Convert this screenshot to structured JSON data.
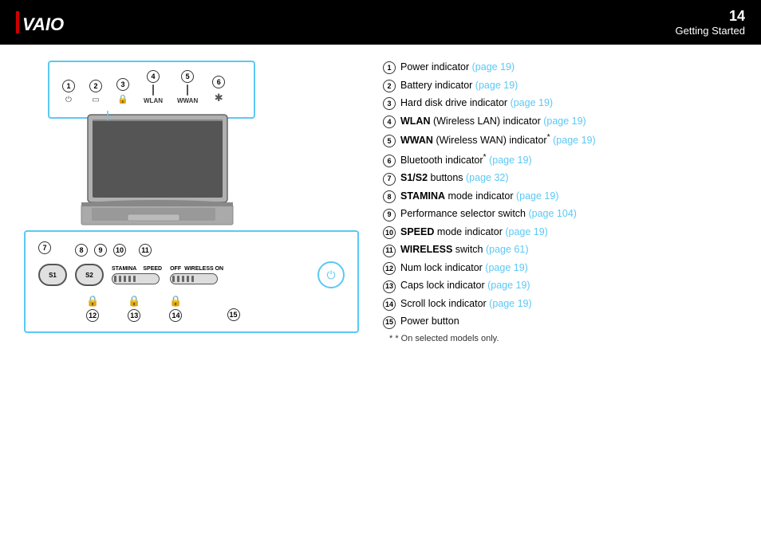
{
  "header": {
    "logo": "VAIO",
    "page_number": "14",
    "section": "Getting Started"
  },
  "items": [
    {
      "num": "1",
      "text": "Power indicator ",
      "link": "page 19",
      "link_page": "19",
      "bold": ""
    },
    {
      "num": "2",
      "text": "Battery indicator ",
      "link": "page 19",
      "bold": ""
    },
    {
      "num": "3",
      "text": "Hard disk drive indicator ",
      "link": "page 19",
      "bold": ""
    },
    {
      "num": "4",
      "text": " (Wireless LAN) indicator ",
      "link": "page 19",
      "bold": "WLAN"
    },
    {
      "num": "5",
      "text": " (Wireless WAN) indicator* ",
      "link": "page 19",
      "bold": "WWAN"
    },
    {
      "num": "6",
      "text": "Bluetooth indicator* ",
      "link": "page 19",
      "bold": ""
    },
    {
      "num": "7",
      "text": " buttons ",
      "link": "page 32",
      "bold": "S1/S2"
    },
    {
      "num": "8",
      "text": " mode indicator ",
      "link": "page 19",
      "bold": "STAMINA"
    },
    {
      "num": "9",
      "text": "Performance selector switch ",
      "link": "page 104",
      "bold": ""
    },
    {
      "num": "10",
      "text": " mode indicator ",
      "link": "page 19",
      "bold": "SPEED"
    },
    {
      "num": "11",
      "text": " switch ",
      "link": "page 61",
      "bold": "WIRELESS"
    },
    {
      "num": "12",
      "text": "Num lock indicator ",
      "link": "page 19",
      "bold": ""
    },
    {
      "num": "13",
      "text": "Caps lock indicator ",
      "link": "page 19",
      "bold": ""
    },
    {
      "num": "14",
      "text": "Scroll lock indicator ",
      "link": "page 19",
      "bold": ""
    },
    {
      "num": "15",
      "text": "Power button",
      "link": "",
      "bold": ""
    }
  ],
  "footnote": "* On selected models only.",
  "top_indicators": [
    {
      "num": "1",
      "icon": "⏻",
      "label": ""
    },
    {
      "num": "2",
      "icon": "▭",
      "label": ""
    },
    {
      "num": "3",
      "icon": "🔒",
      "label": ""
    },
    {
      "num": "4",
      "icon": "",
      "label": "WLAN"
    },
    {
      "num": "5",
      "icon": "",
      "label": "WWAN"
    },
    {
      "num": "6",
      "icon": "✱",
      "label": ""
    }
  ],
  "bottom_indicators": {
    "left_nums": [
      "7",
      "8",
      "9",
      "10",
      "11"
    ],
    "bottom_nums": [
      "12",
      "13",
      "14",
      "15"
    ]
  }
}
